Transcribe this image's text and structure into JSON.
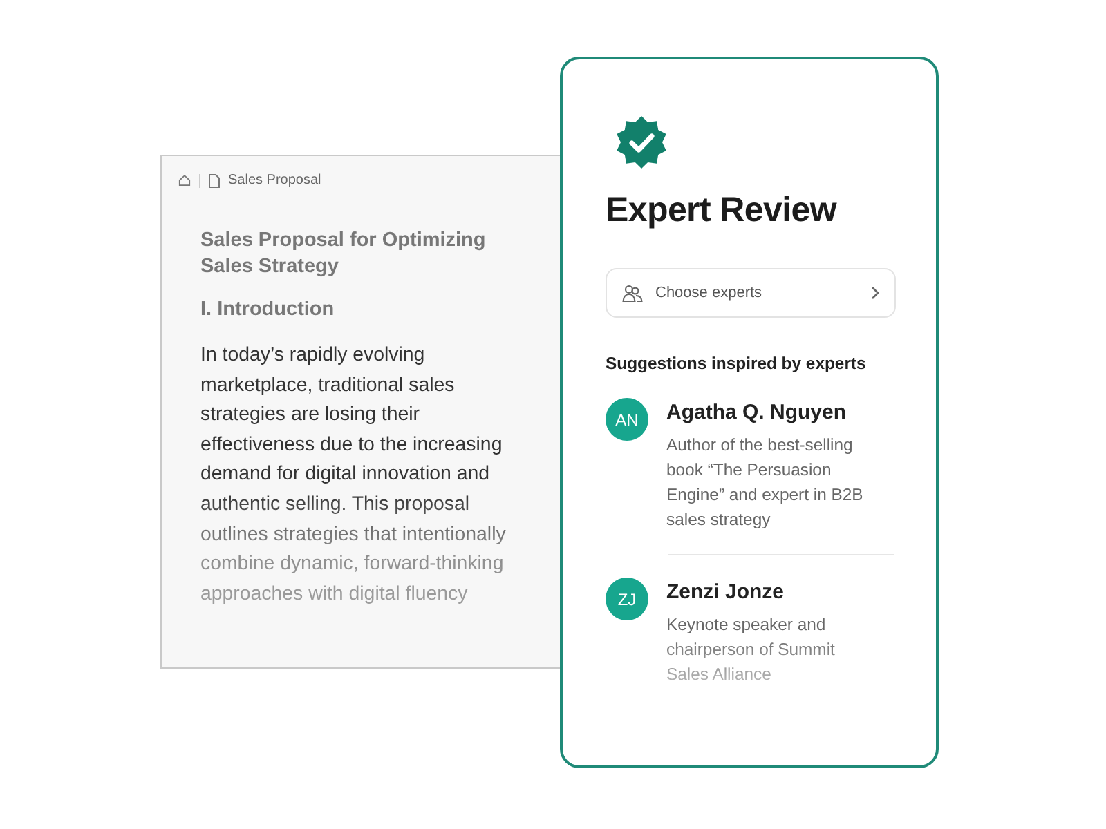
{
  "document": {
    "breadcrumb": "Sales Proposal",
    "title": "Sales Proposal for Optimizing Sales Strategy",
    "heading": "I. Introduction",
    "body": "In today’s rapidly evolving marketplace, traditional sales strategies are losing their effectiveness due to the increasing demand for digital innovation and authentic selling. This proposal outlines strategies that intentionally combine dynamic, forward-thinking approaches with digital fluency"
  },
  "review": {
    "title": "Expert Review",
    "chooser": {
      "label": "Choose experts"
    },
    "suggestions_heading": "Suggestions inspired by experts",
    "experts": [
      {
        "initials": "AN",
        "name": "Agatha Q. Nguyen",
        "bio": "Author of the best-selling book “The Persuasion Engine” and expert in B2B sales strategy"
      },
      {
        "initials": "ZJ",
        "name": "Zenzi Jonze",
        "bio": "Keynote speaker and chairperson of Summit Sales Alliance"
      }
    ]
  }
}
